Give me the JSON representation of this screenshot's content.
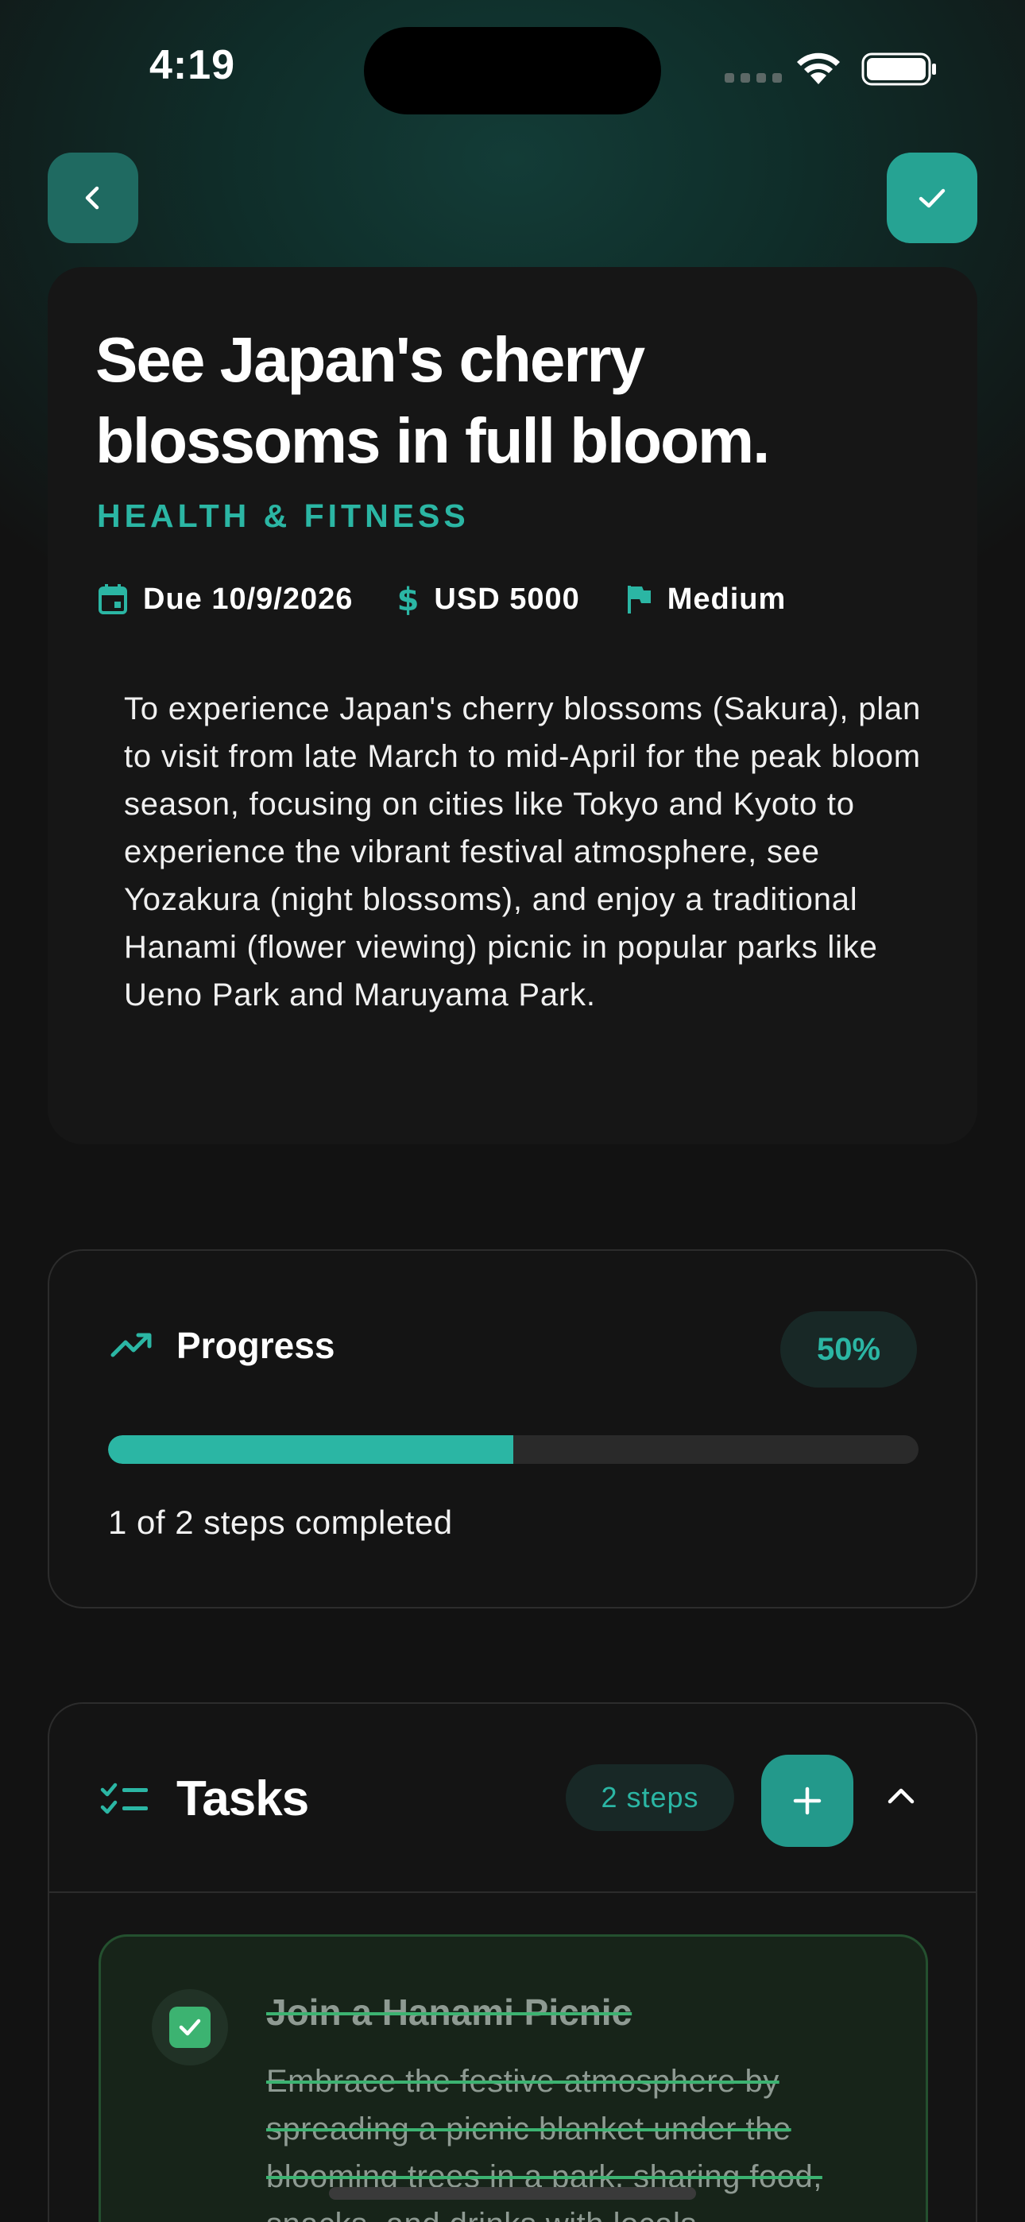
{
  "status_bar": {
    "time": "4:19"
  },
  "goal": {
    "title": "See Japan's cherry blossoms in full bloom.",
    "category": "HEALTH & FITNESS",
    "due": "Due 10/9/2026",
    "budget": "USD 5000",
    "priority": "Medium",
    "description": "To experience Japan's cherry blossoms (Sakura), plan to visit from late March to mid-April for the peak bloom season, focusing on cities like Tokyo and Kyoto to experience the vibrant festival atmosphere, see Yozakura (night blossoms), and enjoy a traditional Hanami (flower viewing) picnic in popular parks like Ueno Park and Maruyama Park."
  },
  "progress": {
    "title": "Progress",
    "percent_label": "50%",
    "fraction": 0.5,
    "steps_text": "1 of 2 steps completed"
  },
  "tasks": {
    "title": "Tasks",
    "steps_badge": "2 steps",
    "items": [
      {
        "title": "Join a Hanami Picnic",
        "description": "Embrace the festive atmosphere by spreading a picnic blanket under the blooming trees in a park, sharing food, snacks, and drinks with locals",
        "completed": true
      }
    ]
  },
  "icons": {
    "back": "chevron-left-icon",
    "confirm": "check-icon",
    "calendar": "calendar-icon",
    "dollar": "dollar-icon",
    "flag": "flag-icon",
    "trend": "trending-up-icon",
    "checklist": "checklist-icon",
    "add": "plus-icon",
    "collapse": "chevron-up-icon"
  },
  "colors": {
    "accent": "#2bb6a4",
    "success": "#3cb371",
    "background": "#121212"
  }
}
